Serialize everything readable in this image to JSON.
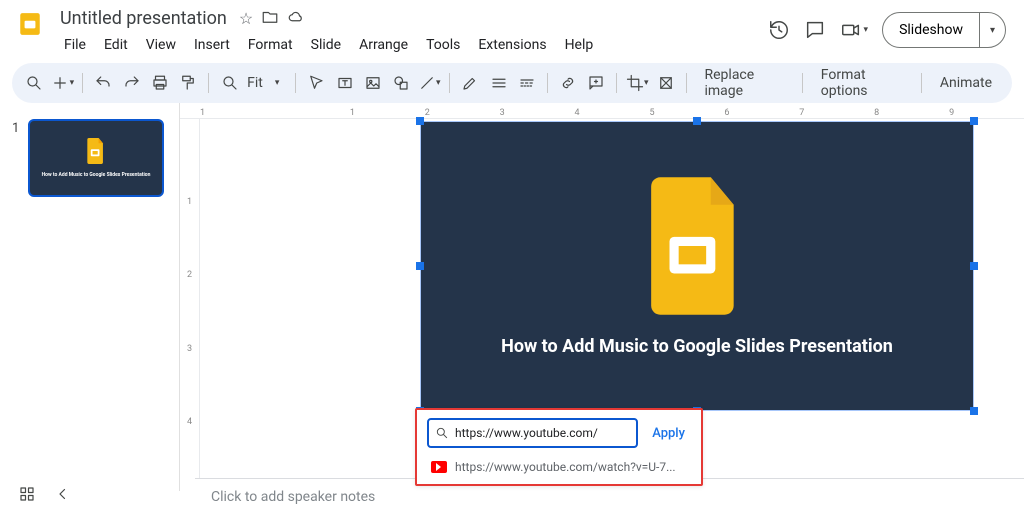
{
  "header": {
    "doc_title": "Untitled presentation",
    "menus": [
      "File",
      "Edit",
      "View",
      "Insert",
      "Format",
      "Slide",
      "Arrange",
      "Tools",
      "Extensions",
      "Help"
    ],
    "slideshow_label": "Slideshow"
  },
  "toolbar": {
    "zoom_label": "Fit",
    "replace_image": "Replace image",
    "format_options": "Format options",
    "animate": "Animate"
  },
  "filmstrip": {
    "slides": [
      {
        "number": "1",
        "title": "How to Add Music to Google Slides Presentation"
      }
    ]
  },
  "slide": {
    "title": "How to Add Music to Google Slides Presentation"
  },
  "ruler": {
    "h": [
      "1",
      "",
      "1",
      "2",
      "3",
      "4",
      "5",
      "6",
      "7",
      "8",
      "9"
    ],
    "v": [
      "",
      "1",
      "2",
      "3",
      "4"
    ]
  },
  "link_popup": {
    "input_value": "https://www.youtube.com/",
    "apply_label": "Apply",
    "result_text": "https://www.youtube.com/watch?v=U-7..."
  },
  "notes": {
    "placeholder": "Click to add speaker notes"
  }
}
